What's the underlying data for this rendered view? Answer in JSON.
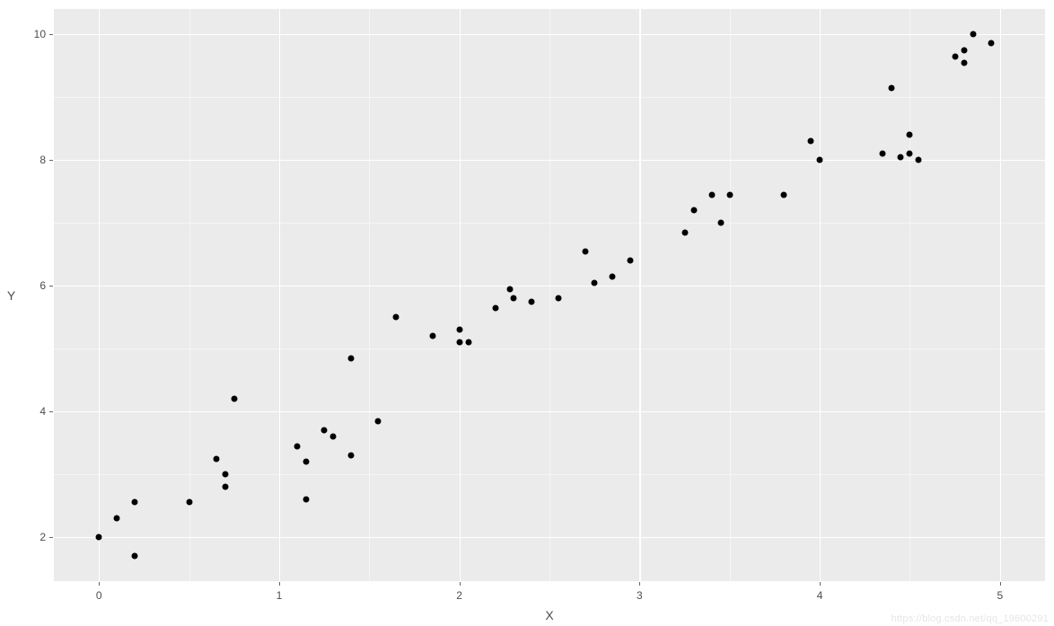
{
  "chart_data": {
    "type": "scatter",
    "title": "",
    "xlabel": "X",
    "ylabel": "Y",
    "xlim": [
      -0.25,
      5.25
    ],
    "ylim": [
      1.3,
      10.4
    ],
    "x_ticks": [
      0,
      1,
      2,
      3,
      4,
      5
    ],
    "y_ticks": [
      2,
      4,
      6,
      8,
      10
    ],
    "x_minor_ticks": [
      0.5,
      1.5,
      2.5,
      3.5,
      4.5
    ],
    "y_minor_ticks": [
      3,
      5,
      7,
      9
    ],
    "points": [
      {
        "x": 0.0,
        "y": 2.0
      },
      {
        "x": 0.1,
        "y": 2.3
      },
      {
        "x": 0.2,
        "y": 2.55
      },
      {
        "x": 0.2,
        "y": 1.7
      },
      {
        "x": 0.5,
        "y": 2.55
      },
      {
        "x": 0.65,
        "y": 3.25
      },
      {
        "x": 0.7,
        "y": 3.0
      },
      {
        "x": 0.7,
        "y": 2.8
      },
      {
        "x": 0.75,
        "y": 4.2
      },
      {
        "x": 1.1,
        "y": 3.45
      },
      {
        "x": 1.15,
        "y": 3.2
      },
      {
        "x": 1.15,
        "y": 2.6
      },
      {
        "x": 1.25,
        "y": 3.7
      },
      {
        "x": 1.3,
        "y": 3.6
      },
      {
        "x": 1.4,
        "y": 4.85
      },
      {
        "x": 1.4,
        "y": 3.3
      },
      {
        "x": 1.55,
        "y": 3.85
      },
      {
        "x": 1.65,
        "y": 5.5
      },
      {
        "x": 1.85,
        "y": 5.2
      },
      {
        "x": 2.0,
        "y": 5.3
      },
      {
        "x": 2.0,
        "y": 5.1
      },
      {
        "x": 2.05,
        "y": 5.1
      },
      {
        "x": 2.2,
        "y": 5.65
      },
      {
        "x": 2.28,
        "y": 5.95
      },
      {
        "x": 2.3,
        "y": 5.8
      },
      {
        "x": 2.4,
        "y": 5.75
      },
      {
        "x": 2.55,
        "y": 5.8
      },
      {
        "x": 2.7,
        "y": 6.55
      },
      {
        "x": 2.75,
        "y": 6.05
      },
      {
        "x": 2.85,
        "y": 6.15
      },
      {
        "x": 2.95,
        "y": 6.4
      },
      {
        "x": 3.25,
        "y": 6.85
      },
      {
        "x": 3.3,
        "y": 7.2
      },
      {
        "x": 3.4,
        "y": 7.45
      },
      {
        "x": 3.45,
        "y": 7.0
      },
      {
        "x": 3.5,
        "y": 7.45
      },
      {
        "x": 3.8,
        "y": 7.45
      },
      {
        "x": 3.95,
        "y": 8.3
      },
      {
        "x": 4.0,
        "y": 8.0
      },
      {
        "x": 4.35,
        "y": 8.1
      },
      {
        "x": 4.4,
        "y": 9.15
      },
      {
        "x": 4.45,
        "y": 8.05
      },
      {
        "x": 4.5,
        "y": 8.1
      },
      {
        "x": 4.5,
        "y": 8.4
      },
      {
        "x": 4.55,
        "y": 8.0
      },
      {
        "x": 4.75,
        "y": 9.65
      },
      {
        "x": 4.8,
        "y": 9.55
      },
      {
        "x": 4.8,
        "y": 9.75
      },
      {
        "x": 4.85,
        "y": 10.0
      },
      {
        "x": 4.95,
        "y": 9.85
      }
    ]
  },
  "watermark": "https://blog.csdn.net/qq_19600291"
}
